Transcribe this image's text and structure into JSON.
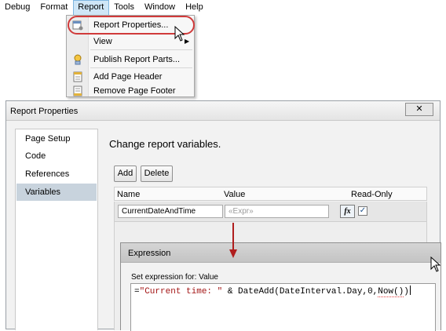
{
  "menubar": {
    "items": [
      "Debug",
      "Format",
      "Report",
      "Tools",
      "Window",
      "Help"
    ],
    "active": "Report"
  },
  "report_menu": {
    "items": [
      {
        "label": "Report Properties...",
        "icon": "report-properties-icon"
      },
      {
        "label": "View",
        "icon": null,
        "submenu_arrow": "▶"
      },
      {
        "label": "Publish Report Parts...",
        "icon": "publish-parts-icon"
      },
      {
        "label": "Add Page Header",
        "icon": "page-header-icon"
      },
      {
        "label": "Remove Page Footer",
        "icon": "page-footer-icon"
      }
    ]
  },
  "dialog": {
    "title": "Report Properties",
    "close_glyph": "✕",
    "nav": [
      "Page Setup",
      "Code",
      "References",
      "Variables"
    ],
    "selected_nav": "Variables",
    "heading": "Change report variables.",
    "buttons": {
      "add": "Add",
      "delete": "Delete"
    },
    "grid": {
      "columns": [
        "Name",
        "Value",
        "Read-Only"
      ],
      "rows": [
        {
          "name": "CurrentDateAndTime",
          "value_placeholder": "«Expr»",
          "fx": "fx",
          "read_only": true,
          "check_glyph": "✓"
        }
      ]
    }
  },
  "expression_dialog": {
    "title": "Expression",
    "label": "Set expression for: Value",
    "code_prefix": "=",
    "code_string": "\"Current time: \"",
    "code_middle": " & DateAdd(DateInterval.Day,0,",
    "code_squiggle": "Now()",
    "code_suffix": ")"
  },
  "colors": {
    "highlight_ring": "#d03a3a",
    "menu_active": "#cfe6f7",
    "nav_selected": "#c8d3dd",
    "string_literal": "#a31515"
  }
}
